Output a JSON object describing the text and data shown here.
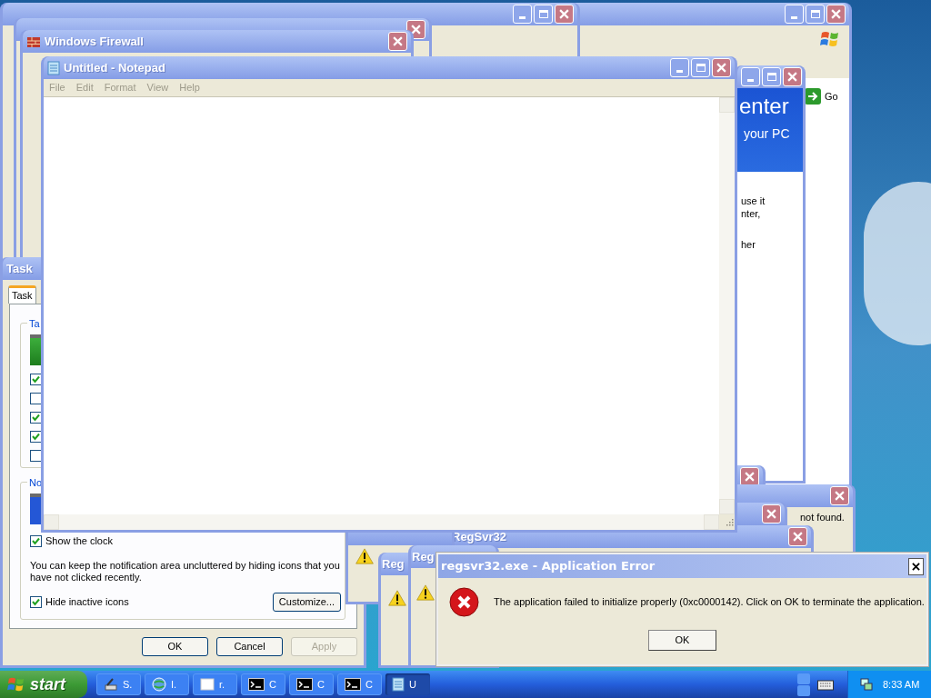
{
  "browser_window": {
    "go_button": "Go"
  },
  "security_center": {
    "heading": "enter",
    "subheading": "your PC",
    "text_lines": [
      "use it",
      "nter,",
      "her"
    ]
  },
  "firewall_window": {
    "title": "Windows Firewall"
  },
  "taskbar_properties": {
    "title": "Task",
    "tabs": [
      {
        "label": "Task",
        "selected": true
      }
    ],
    "appearance_group": {
      "label": "Ta",
      "options": [
        {
          "checked": true
        },
        {
          "checked": false
        },
        {
          "checked": true
        },
        {
          "checked": true
        },
        {
          "checked": false
        }
      ]
    },
    "notification_group": {
      "label": "No",
      "show_clock": {
        "label": "Show the clock",
        "checked": true
      },
      "description": "You can keep the notification area uncluttered by hiding icons that you have not clicked recently.",
      "hide_inactive": {
        "label": "Hide inactive icons",
        "checked": true
      },
      "customize_button": "Customize..."
    },
    "buttons": [
      {
        "label": "OK",
        "disabled": false
      },
      {
        "label": "Cancel",
        "disabled": false
      },
      {
        "label": "Apply",
        "disabled": true
      }
    ]
  },
  "regsvr_windows": [
    {
      "title": "RegSvr32"
    },
    {
      "title": "Reg"
    },
    {
      "title": "Reg"
    }
  ],
  "message_fragment": "not found.",
  "notepad": {
    "title": "Untitled - Notepad",
    "menu": [
      "File",
      "Edit",
      "Format",
      "View",
      "Help"
    ]
  },
  "error_dialog": {
    "title": "regsvr32.exe - Application Error",
    "message": "The application failed to initialize properly (0xc0000142). Click on OK to terminate the application.",
    "button": "OK"
  },
  "taskbar": {
    "start": "start",
    "items": [
      {
        "label": "S.",
        "kind": "tool",
        "selected": false
      },
      {
        "label": "I.",
        "kind": "globe",
        "selected": false
      },
      {
        "label": "r.",
        "kind": "window",
        "selected": false
      },
      {
        "label": "C",
        "kind": "console",
        "selected": false
      },
      {
        "label": "C",
        "kind": "console",
        "selected": false
      },
      {
        "label": "C",
        "kind": "console",
        "selected": false
      },
      {
        "label": "U",
        "kind": "notepad",
        "selected": true
      }
    ],
    "clock": "8:33 AM"
  }
}
